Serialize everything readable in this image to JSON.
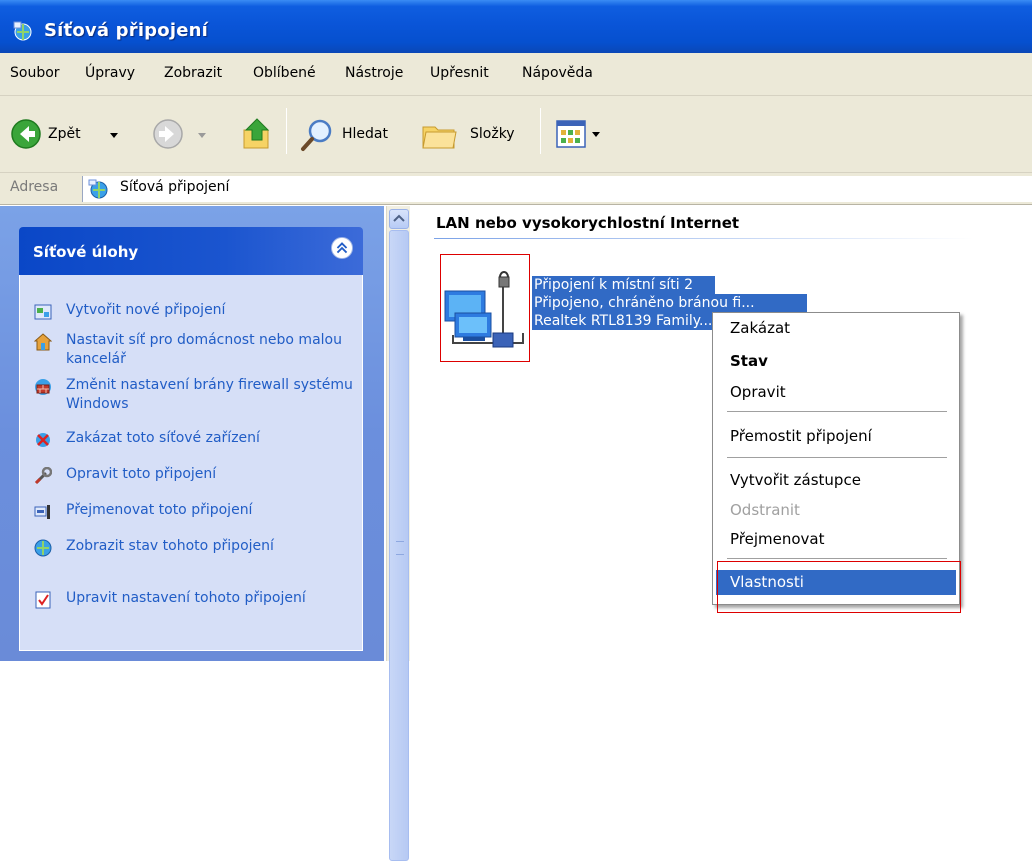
{
  "window": {
    "title": "Síťová připojení"
  },
  "menubar": {
    "items": [
      "Soubor",
      "Úpravy",
      "Zobrazit",
      "Oblíbené",
      "Nástroje",
      "Upřesnit",
      "Nápověda"
    ]
  },
  "toolbar": {
    "back_label": "Zpět",
    "search_label": "Hledat",
    "folders_label": "Složky"
  },
  "address": {
    "label": "Adresa",
    "value": "Síťová připojení"
  },
  "taskpane": {
    "header": "Síťové úlohy",
    "tasks": [
      {
        "label": "Vytvořit nové připojení",
        "icon": "new-connection-icon"
      },
      {
        "label": "Nastavit síť pro domácnost nebo malou kancelář",
        "icon": "home-network-icon"
      },
      {
        "label": "Změnit nastavení brány firewall systému Windows",
        "icon": "firewall-icon"
      },
      {
        "label": "Zakázat toto síťové zařízení",
        "icon": "disable-device-icon"
      },
      {
        "label": "Opravit toto připojení",
        "icon": "repair-icon"
      },
      {
        "label": "Přejmenovat toto připojení",
        "icon": "rename-icon"
      },
      {
        "label": "Zobrazit stav tohoto připojení",
        "icon": "status-icon"
      },
      {
        "label": "Upravit nastavení tohoto připojení",
        "icon": "settings-icon"
      }
    ]
  },
  "main": {
    "group_title": "LAN nebo vysokorychlostní Internet",
    "item": {
      "name": "Připojení k místní síti 2",
      "status": "Připojeno, chráněno bránou fi...",
      "device": "Realtek RTL8139 Family..."
    }
  },
  "context_menu": {
    "items": [
      {
        "label": "Zakázat"
      },
      {
        "label": "Stav",
        "bold": true
      },
      {
        "label": "Opravit"
      },
      {
        "label": "Přemostit připojení"
      },
      {
        "label": "Vytvořit zástupce"
      },
      {
        "label": "Odstranit",
        "disabled": true
      },
      {
        "label": "Přejmenovat"
      },
      {
        "label": "Vlastnosti",
        "selected": true
      }
    ]
  },
  "colors": {
    "titlebar": "#0a55d8",
    "chrome": "#ece9d8",
    "taskpane_bg": "#6b8fdd",
    "task_link": "#215dc6",
    "selection": "#316ac5",
    "annotation": "#dd0000"
  }
}
